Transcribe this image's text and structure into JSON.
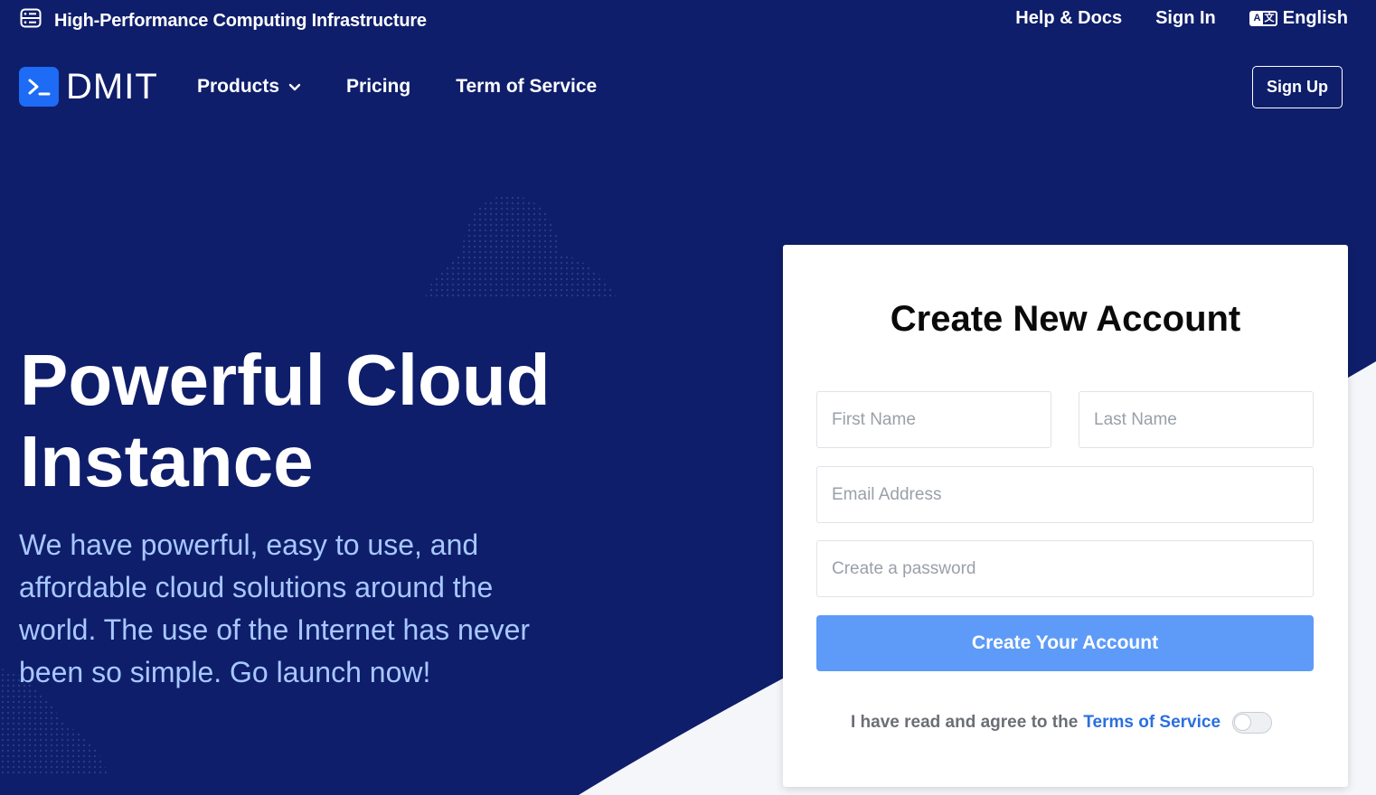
{
  "topbar": {
    "title": "High-Performance Computing Infrastructure",
    "help_docs": "Help & Docs",
    "sign_in": "Sign In",
    "language": "English"
  },
  "nav": {
    "brand": "DMIT",
    "items": [
      {
        "label": "Products"
      },
      {
        "label": "Pricing"
      },
      {
        "label": "Term of Service"
      }
    ],
    "sign_up": "Sign Up"
  },
  "hero": {
    "title_line1": "Powerful Cloud",
    "title_line2": "Instance",
    "description": "We have powerful, easy to use, and affordable cloud solutions around the world. The use of the Internet has never been so simple. Go launch now!"
  },
  "signup_form": {
    "heading": "Create New Account",
    "first_name": {
      "value": "",
      "placeholder": "First Name"
    },
    "last_name": {
      "value": "",
      "placeholder": "Last Name"
    },
    "email": {
      "value": "",
      "placeholder": "Email Address"
    },
    "password": {
      "value": "",
      "placeholder": "Create a password"
    },
    "submit_label": "Create Your Account",
    "agree_text": "I have read and agree to the",
    "terms_link": "Terms of Service",
    "agree_checked": false
  },
  "icons": {
    "topbar": "server-icon",
    "logo": "terminal-icon",
    "products_dropdown": "chevron-down-icon",
    "language": "translate-icon"
  },
  "colors": {
    "background": "#0f1e6b",
    "brand_blue": "#1e6bf5",
    "button": "#5e9bf8",
    "link": "#2a6fe0",
    "hero_text": "#a7c8ff"
  }
}
